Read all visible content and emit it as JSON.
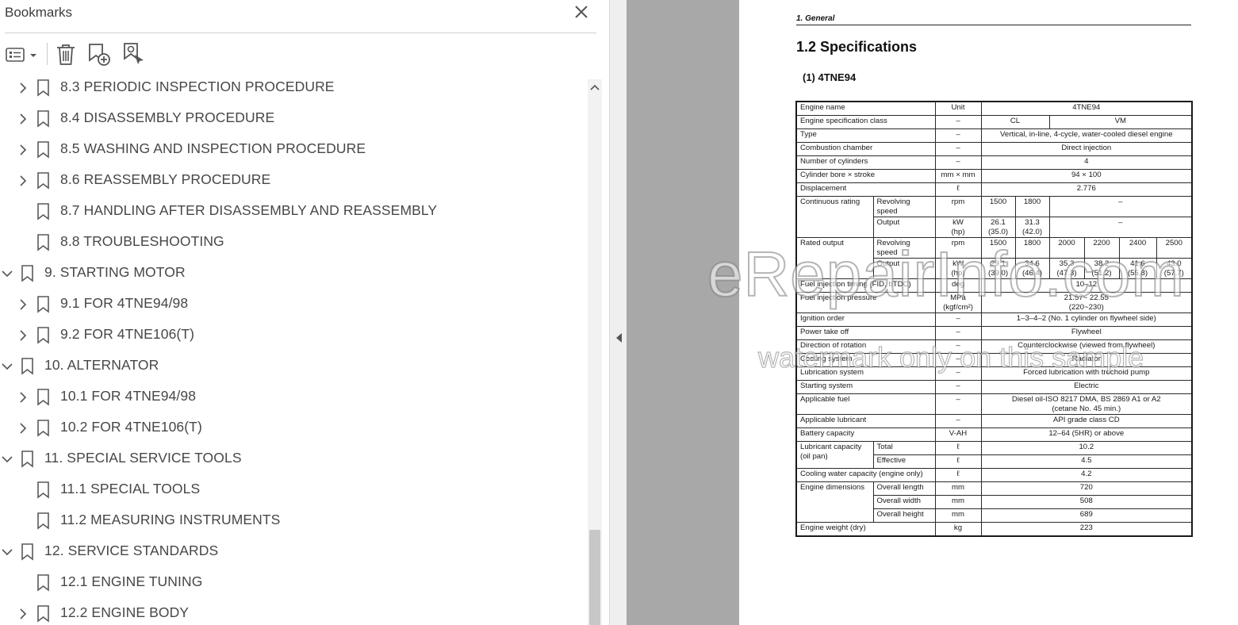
{
  "panel": {
    "title": "Bookmarks",
    "items": [
      {
        "label": "8.3 PERIODIC INSPECTION PROCEDURE",
        "level": 2,
        "expander": "collapsed"
      },
      {
        "label": "8.4 DISASSEMBLY PROCEDURE",
        "level": 2,
        "expander": "collapsed"
      },
      {
        "label": "8.5 WASHING AND INSPECTION PROCEDURE",
        "level": 2,
        "expander": "collapsed"
      },
      {
        "label": "8.6 REASSEMBLY PROCEDURE",
        "level": 2,
        "expander": "collapsed"
      },
      {
        "label": "8.7 HANDLING AFTER DISASSEMBLY AND REASSEMBLY",
        "level": 2,
        "expander": "none"
      },
      {
        "label": "8.8 TROUBLESHOOTING",
        "level": 2,
        "expander": "none"
      },
      {
        "label": "9. STARTING MOTOR",
        "level": 1,
        "expander": "expanded"
      },
      {
        "label": "9.1 FOR 4TNE94/98",
        "level": 2,
        "expander": "collapsed"
      },
      {
        "label": "9.2 FOR 4TNE106(T)",
        "level": 2,
        "expander": "collapsed"
      },
      {
        "label": "10. ALTERNATOR",
        "level": 1,
        "expander": "expanded"
      },
      {
        "label": "10.1 FOR 4TNE94/98",
        "level": 2,
        "expander": "collapsed"
      },
      {
        "label": "10.2 FOR 4TNE106(T)",
        "level": 2,
        "expander": "collapsed"
      },
      {
        "label": "11. SPECIAL SERVICE TOOLS",
        "level": 1,
        "expander": "expanded"
      },
      {
        "label": "11.1 SPECIAL TOOLS",
        "level": 2,
        "expander": "none"
      },
      {
        "label": "11.2 MEASURING INSTRUMENTS",
        "level": 2,
        "expander": "none"
      },
      {
        "label": "12. SERVICE STANDARDS",
        "level": 1,
        "expander": "expanded"
      },
      {
        "label": "12.1 ENGINE TUNING",
        "level": 2,
        "expander": "none"
      },
      {
        "label": "12.2 ENGINE BODY",
        "level": 2,
        "expander": "collapsed"
      }
    ]
  },
  "toolbar_icons": [
    "options-menu-icon",
    "delete-icon",
    "new-bookmark-icon",
    "find-bookmark-icon"
  ],
  "doc": {
    "header": "1.  General",
    "heading": "1.2 Specifications",
    "subheading": "(1) 4TNE94",
    "table": {
      "engine_name": "Engine name",
      "unit_label": "Unit",
      "model": "4TNE94",
      "spec_class": "Engine specification class",
      "dash": "–",
      "cl": "CL",
      "vm": "VM",
      "type": "Type",
      "type_val": "Vertical, in-line, 4-cycle, water-cooled diesel engine",
      "combustion": "Combustion chamber",
      "combustion_val": "Direct injection",
      "cylinders": "Number of cylinders",
      "cylinders_val": "4",
      "bore": "Cylinder bore × stroke",
      "bore_unit": "mm  × mm",
      "bore_val": "94 × 100",
      "displacement": "Displacement",
      "liter": "ℓ",
      "displacement_val": "2.776",
      "cont_rating": "Continuous rating",
      "rev_speed": "Revolving speed",
      "rpm": "rpm",
      "cont_1500": "1500",
      "cont_1800": "1800",
      "output": "Output",
      "kw": "kW",
      "hp": "(hp)",
      "cont_out_1500": "26.1",
      "cont_hp_1500": "(35.0)",
      "cont_out_1800": "31.3",
      "cont_hp_1800": "(42.0)",
      "rated_output": "Rated output",
      "rated_speeds": [
        "1500",
        "1800",
        "2000",
        "2200",
        "2400",
        "2500"
      ],
      "rated_kw": [
        "29.1",
        "34.6",
        "35.3",
        "38.2",
        "41.6",
        "43.0"
      ],
      "rated_hp": [
        "(39.0)",
        "(46.4)",
        "(47.3)",
        "(51.2)",
        "(55.8)",
        "(57.7)"
      ],
      "timing": "Fuel injection timing  (FID, bTDC)",
      "deg": "deg",
      "timing_val": "10–12",
      "pressure": "Fuel injection pressure",
      "mpa": "MPa",
      "kgf": "(kgf/cm²)",
      "pressure_val": "21.57~ 22.55",
      "pressure_val2": "(220~230)",
      "ignition": "Ignition order",
      "ignition_val": "1–3–4–2 (No. 1 cylinder on flywheel side)",
      "pto": "Power take off",
      "pto_val": "Flywheel",
      "rotation": "Direction of rotation",
      "rotation_val": "Counterclockwise (viewed from flywheel)",
      "cooling": "Cooling system",
      "cooling_val": "Radiator",
      "lubrication": "Lubrication system",
      "lubrication_val": "Forced lubrication with trochoid pump",
      "starting": "Starting system",
      "starting_val": "Electric",
      "fuel": "Applicable fuel",
      "fuel_val": "Diesel oil-ISO 8217 DMA, BS 2869 A1 or A2",
      "fuel_val2": "(cetane No. 45 min.)",
      "lubricant": "Applicable lubricant",
      "lubricant_val": "API grade class CD",
      "battery": "Battery capacity",
      "battery_unit": "V-AH",
      "battery_val": "12–64 (5HR) or above",
      "lub_capacity": "Lubricant capacity (oil pan)",
      "total": "Total",
      "total_val": "10.2",
      "effective": "Effective",
      "effective_val": "4.5",
      "water_capacity": "Cooling water capacity (engine only)",
      "water_val": "4.2",
      "dimensions": "Engine dimensions",
      "length": "Overall length",
      "mm": "mm",
      "length_val": "720",
      "width": "Overall width",
      "width_val": "508",
      "height": "Overall height",
      "height_val": "689",
      "weight": "Engine weight (dry)",
      "kg": "kg",
      "weight_val": "223"
    }
  },
  "watermark": {
    "line1": "eRepairInfo.com",
    "line2": "watermark only on this sample"
  }
}
